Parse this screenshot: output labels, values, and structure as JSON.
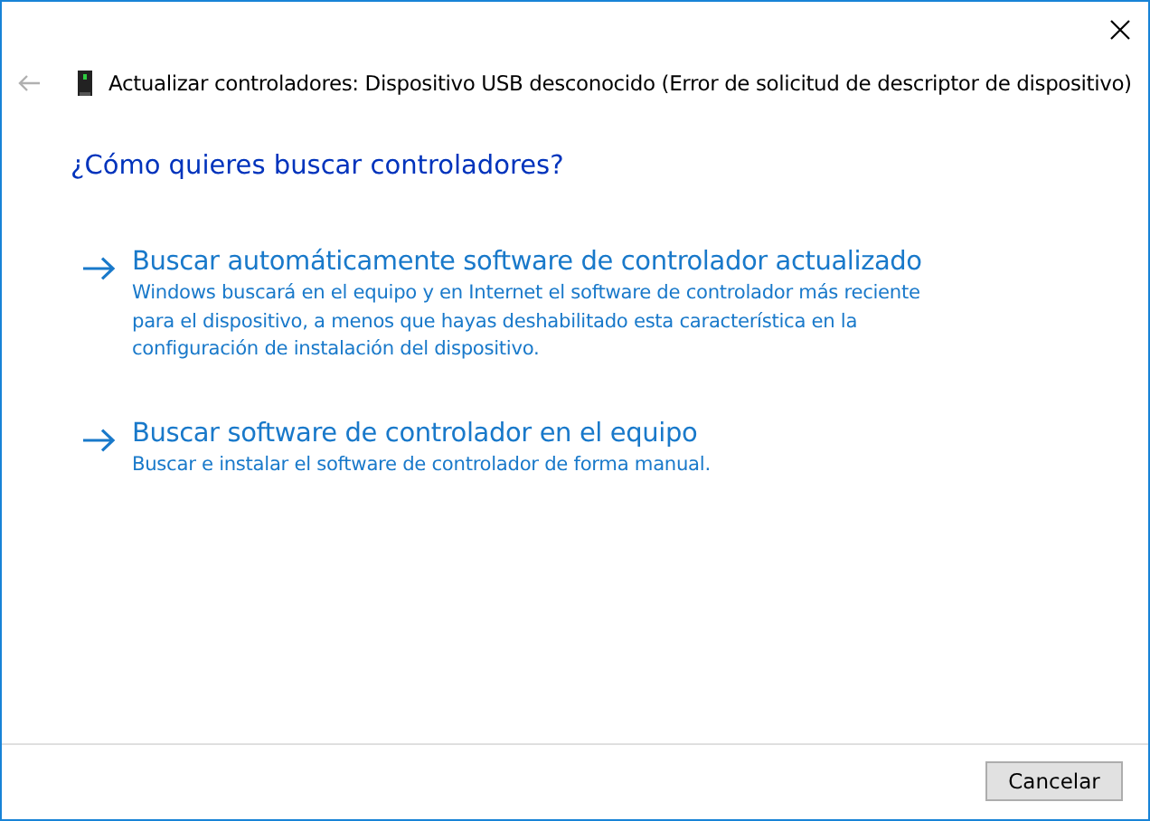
{
  "window": {
    "title": "Actualizar controladores: Dispositivo USB desconocido (Error de solicitud de descriptor de dispositivo)"
  },
  "heading": "¿Cómo quieres buscar controladores?",
  "options": [
    {
      "title": "Buscar automáticamente software de controlador actualizado",
      "description": "Windows buscará en el equipo y en Internet el software de controlador más reciente para el dispositivo, a menos que hayas deshabilitado esta característica en la configuración de instalación del dispositivo."
    },
    {
      "title": "Buscar software de controlador en el equipo",
      "description": "Buscar e instalar el software de controlador de forma manual."
    }
  ],
  "buttons": [
    "Cancelar"
  ]
}
